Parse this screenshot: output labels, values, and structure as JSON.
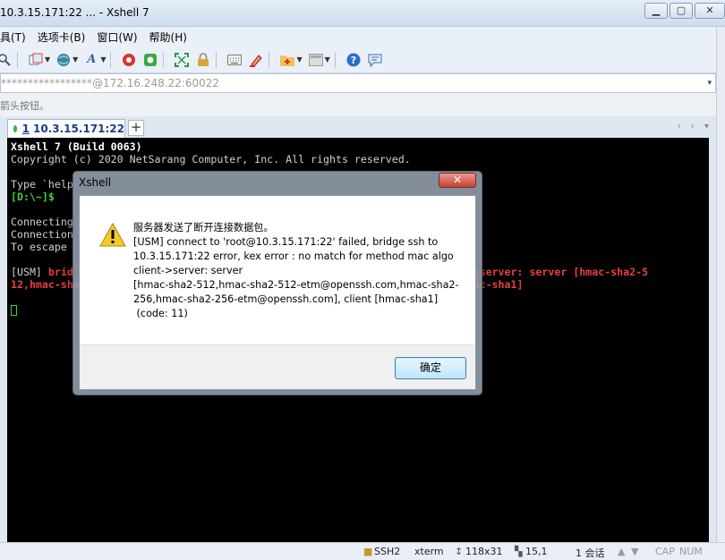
{
  "window": {
    "title": "10.3.15.171:22 ... - Xshell 7",
    "minimize": "▁",
    "maximize": "▢",
    "close": "✕"
  },
  "menu": [
    "具(T)",
    "选项卡(B)",
    "窗口(W)",
    "帮助(H)"
  ],
  "address": {
    "value": "*****************@172.16.248.22:60022",
    "caret": "▾"
  },
  "hint": "箭头按钮。",
  "tab": {
    "number": "1",
    "label": "10.3.15.171:22",
    "new_tab": "+",
    "nav": "‹ › ▾"
  },
  "terminal": {
    "line1": "Xshell 7 (Build 0063)",
    "line2": "Copyright (c) 2020 NetSarang Computer, Inc. All rights reserved.",
    "line3": "",
    "line4": "Type `help",
    "line5_prompt": "[D:\\~]$",
    "line6": "",
    "line7": "Connecting",
    "line8": "Connection",
    "line9": "To escape",
    "line10": "",
    "line11_prefix": "[USM] ",
    "line11_red": "brid",
    "line11_tail": "o client->server: server [hmac-sha2-5",
    "line12_red": "12,hmac-sha",
    "line12_tail": "ient [hmac-sha1]"
  },
  "dialog": {
    "title": "Xshell",
    "close": "✕",
    "message_lines": [
      "服务器发送了断开连接数据包。",
      "[USM] connect to 'root@10.3.15.171:22' failed, bridge ssh to",
      "10.3.15.171:22 error, kex error : no match for method mac algo",
      "client->server: server",
      "[hmac-sha2-512,hmac-sha2-512-etm@openssh.com,hmac-sha2-",
      "256,hmac-sha2-256-etm@openssh.com], client [hmac-sha1]",
      " (code: 11)"
    ],
    "ok_label": "确定"
  },
  "status": {
    "protocol": "SSH2",
    "terminal_type": "xterm",
    "size": "118x31",
    "position": "15,1",
    "sessions": "1 会话",
    "caps": "CAP",
    "num": "NUM"
  },
  "colors": {
    "terminal_bg": "#000000",
    "prompt_green": "#3ad43a",
    "error_red": "#e8403a",
    "tab_dot": "#2fb84a"
  }
}
